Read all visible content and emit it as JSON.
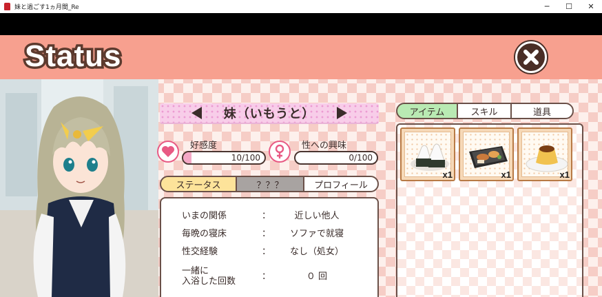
{
  "window": {
    "title": "妹と過ごす1ヵ月間_Re",
    "minimize_glyph": "─",
    "maximize_glyph": "☐",
    "close_glyph": "✕"
  },
  "header": {
    "title": "Status",
    "close_icon": "close-icon"
  },
  "character": {
    "name": "妹（いもうと）"
  },
  "stats": {
    "affection": {
      "label": "好感度",
      "value_text": "10/100",
      "value": 10,
      "max": 100,
      "icon": "heart-icon"
    },
    "interest": {
      "label": "性への興味",
      "value_text": "0/100",
      "value": 0,
      "max": 100,
      "icon": "female-symbol-icon"
    }
  },
  "left_tabs": [
    {
      "label": "ステータス",
      "active": true
    },
    {
      "label": "？？？",
      "active": false
    },
    {
      "label": "プロフィール",
      "active": false
    }
  ],
  "info_rows": [
    {
      "key": "いまの関係",
      "colon": "：",
      "value": "近しい他人"
    },
    {
      "key": "毎晩の寝床",
      "colon": "：",
      "value": "ソファで就寝"
    },
    {
      "key": "性交経験",
      "colon": "：",
      "value": "なし（処女）"
    },
    {
      "key_line1": "一緒に",
      "key_line2": "入浴した回数",
      "colon": "：",
      "value": "０ 回"
    }
  ],
  "right_tabs": [
    {
      "label": "アイテム",
      "active": true
    },
    {
      "label": "スキル",
      "active": false
    },
    {
      "label": "道具",
      "active": false
    }
  ],
  "items": [
    {
      "icon": "onigiri-icon",
      "qty": "x1"
    },
    {
      "icon": "bento-icon",
      "qty": "x1"
    },
    {
      "icon": "pudding-icon",
      "qty": "x1"
    }
  ],
  "colors": {
    "header_band": "#f7a08f",
    "title_outline": "#5c3a2e",
    "tab_active_left": "#fde39a",
    "tab_mid": "#a8a3a1",
    "tab_active_right": "#b9eab3",
    "gauge_fill": "#f4a8c6",
    "heart": "#e85a84"
  }
}
